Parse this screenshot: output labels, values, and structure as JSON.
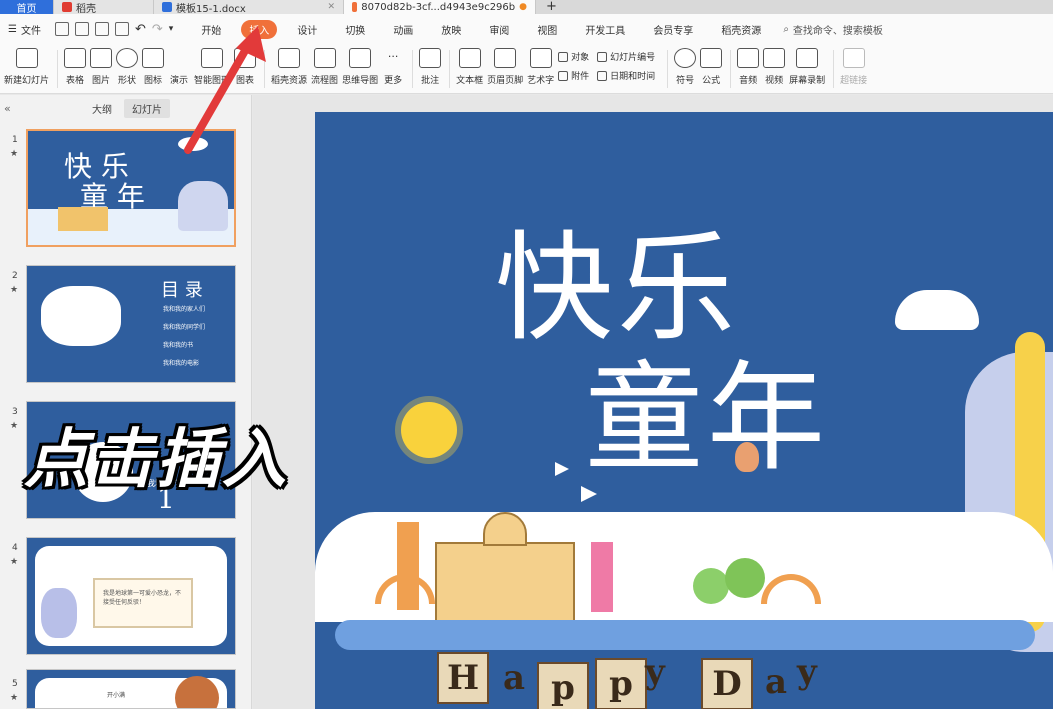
{
  "tabs": {
    "home": "首页",
    "daoke": "稻壳",
    "doc": "模板15-1.docx",
    "active": "8070d82b-3cf...d4943e9c296b"
  },
  "menubar": {
    "file": "文件",
    "items": [
      "开始",
      "插入",
      "设计",
      "切换",
      "动画",
      "放映",
      "审阅",
      "视图",
      "开发工具",
      "会员专享",
      "稻壳资源"
    ],
    "search": "查找命令、搜索模板"
  },
  "ribbon": {
    "new_slide": "新建幻灯片",
    "table": "表格",
    "picture": "图片",
    "shape": "形状",
    "icon": "图标",
    "demo": "演示",
    "smart_art": "智能图形",
    "chart": "图表",
    "daoke_res": "稻壳资源",
    "flowchart": "流程图",
    "mindmap": "思维导图",
    "more": "更多",
    "comment": "批注",
    "textbox": "文本框",
    "header_footer": "页眉页脚",
    "wordart": "艺术字",
    "object": "对象",
    "attachment": "附件",
    "slide_number": "幻灯片编号",
    "date_time": "日期和时间",
    "symbol": "符号",
    "formula": "公式",
    "audio": "音频",
    "video": "视频",
    "screen_record": "屏幕录制",
    "hyperlink": "超链接"
  },
  "leftpanel": {
    "outline": "大纲",
    "slides": "幻灯片"
  },
  "thumbs": {
    "t1": {
      "num": "1",
      "line1": "快 乐",
      "line2": "童 年"
    },
    "t2": {
      "num": "2",
      "title": "目 录",
      "items": [
        "我和我的家人们",
        "我和我的同学们",
        "我和我的书",
        "我和我的电影"
      ]
    },
    "t3": {
      "num": "3",
      "caption": "我和我的家人们",
      "big": "1"
    },
    "t4": {
      "num": "4",
      "note": "我是地球第一可爱小恐龙，不接受任何反驳！"
    },
    "t5": {
      "num": "5",
      "note": "开小满"
    }
  },
  "overlay": "点击插入",
  "slide": {
    "title1": "快乐",
    "title2": "童年",
    "happy": [
      "H",
      "a",
      "p",
      "p",
      "y",
      "D",
      "a",
      "y"
    ]
  }
}
